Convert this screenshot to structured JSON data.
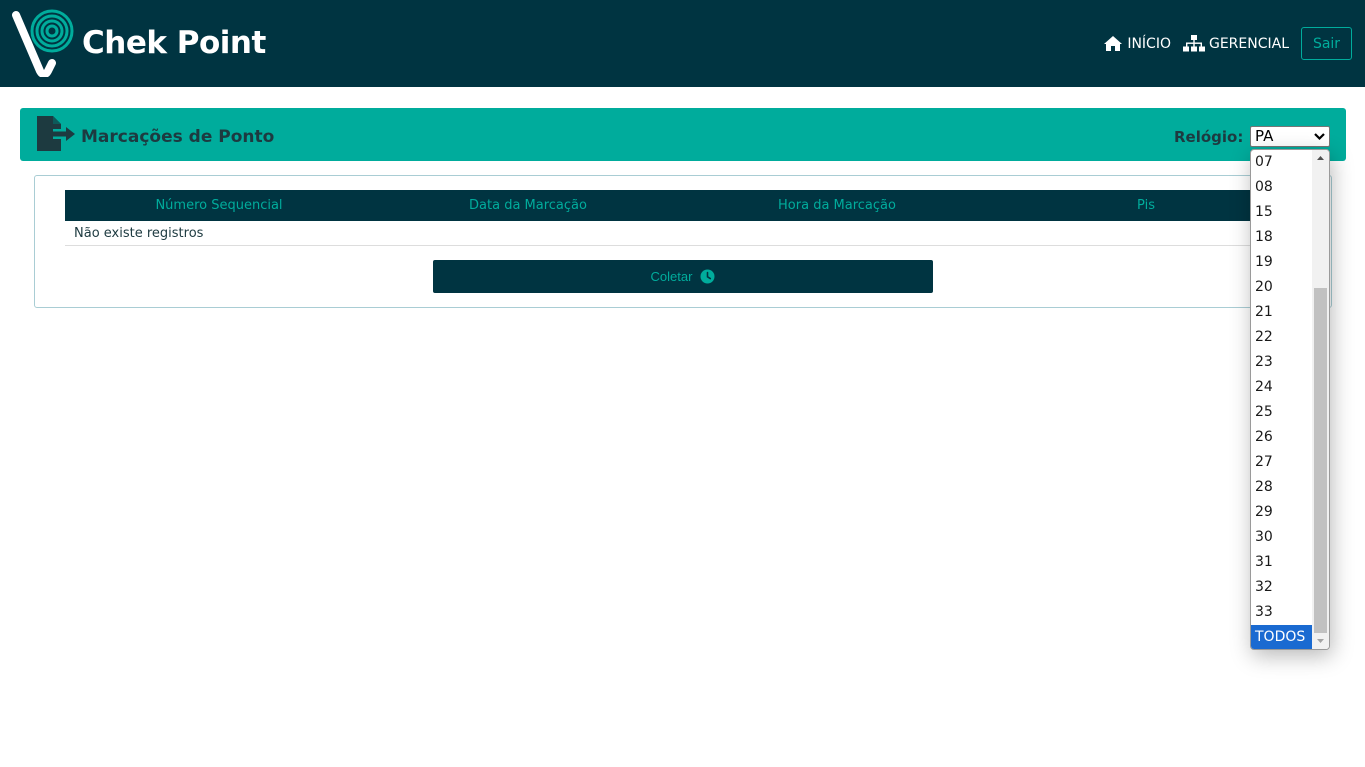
{
  "nav": {
    "brand": "Chek Point",
    "links": [
      {
        "label": "INÍCIO",
        "icon": "home-icon"
      },
      {
        "label": "GERENCIAL",
        "icon": "sitemap-icon"
      }
    ],
    "logout_label": "Sair"
  },
  "panel": {
    "title": "Marcações de Ponto",
    "relogio_label": "Relógio:",
    "relogio_value": "PA"
  },
  "table": {
    "headers": [
      "Número Sequencial",
      "Data da Marcação",
      "Hora da Marcação",
      "Pis"
    ],
    "empty_message": "Não existe registros"
  },
  "collect_button": {
    "label": "Coletar",
    "icon": "clock-icon"
  },
  "dropdown": {
    "options": [
      "07",
      "08",
      "15",
      "18",
      "19",
      "20",
      "21",
      "22",
      "23",
      "24",
      "25",
      "26",
      "27",
      "28",
      "29",
      "30",
      "31",
      "32",
      "33",
      "TODOS"
    ],
    "selected": "TODOS"
  },
  "colors": {
    "navbar": "#003441",
    "accent": "#00ac9c",
    "selected_option": "#1a6ad1"
  }
}
